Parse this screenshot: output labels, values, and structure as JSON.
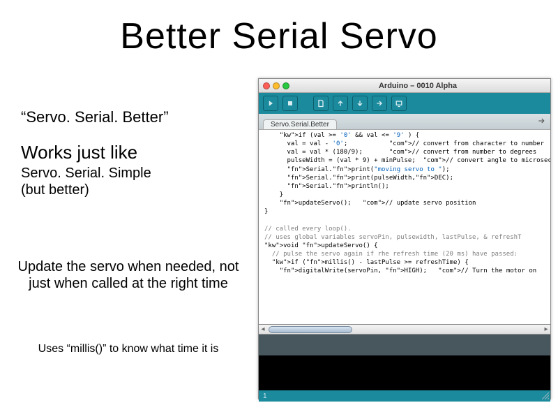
{
  "title": "Better Serial Servo",
  "left": {
    "quote": "“Servo. Serial. Better”",
    "works_heading": "Works just like",
    "works_sub": "Servo. Serial. Simple\n(but better)",
    "para1": "Update the servo when needed, not just when called at the right time",
    "para2": "Uses “millis()” to know what time it is"
  },
  "ide": {
    "window_title": "Arduino – 0010 Alpha",
    "tab_name": "Servo.Serial.Better",
    "toolbar": {
      "verify": "verify-button",
      "stop": "stop-button",
      "new": "new-sketch-button",
      "open": "open-sketch-button",
      "save": "save-sketch-button",
      "upload": "upload-button",
      "serial": "serial-monitor-button"
    },
    "code_lines": [
      {
        "t": "    if (val >= '0' && val <= '9' ) {",
        "cls": ""
      },
      {
        "t": "      val = val - '0';           // convert from character to number",
        "cls": ""
      },
      {
        "t": "      val = val * (180/9);       // convert from number to degrees",
        "cls": ""
      },
      {
        "t": "      pulseWidth = (val * 9) + minPulse;  // convert angle to microsec",
        "cls": ""
      },
      {
        "t": "      Serial.print(\"moving servo to \");",
        "cls": ""
      },
      {
        "t": "      Serial.print(pulseWidth,DEC);",
        "cls": ""
      },
      {
        "t": "      Serial.println();",
        "cls": ""
      },
      {
        "t": "    }",
        "cls": ""
      },
      {
        "t": "    updateServo();   // update servo position",
        "cls": ""
      },
      {
        "t": "}",
        "cls": ""
      },
      {
        "t": "",
        "cls": ""
      },
      {
        "t": "// called every loop().",
        "cls": "com"
      },
      {
        "t": "// uses global variables servoPin, pulsewidth, lastPulse, & refreshT",
        "cls": "com"
      },
      {
        "t": "void updateServo() {",
        "cls": ""
      },
      {
        "t": "  // pulse the servo again if rhe refresh time (20 ms) have passed:",
        "cls": "com"
      },
      {
        "t": "  if (millis() - lastPulse >= refreshTime) {",
        "cls": ""
      },
      {
        "t": "    digitalWrite(servoPin, HIGH);   // Turn the motor on",
        "cls": ""
      }
    ],
    "line_number": "1"
  }
}
